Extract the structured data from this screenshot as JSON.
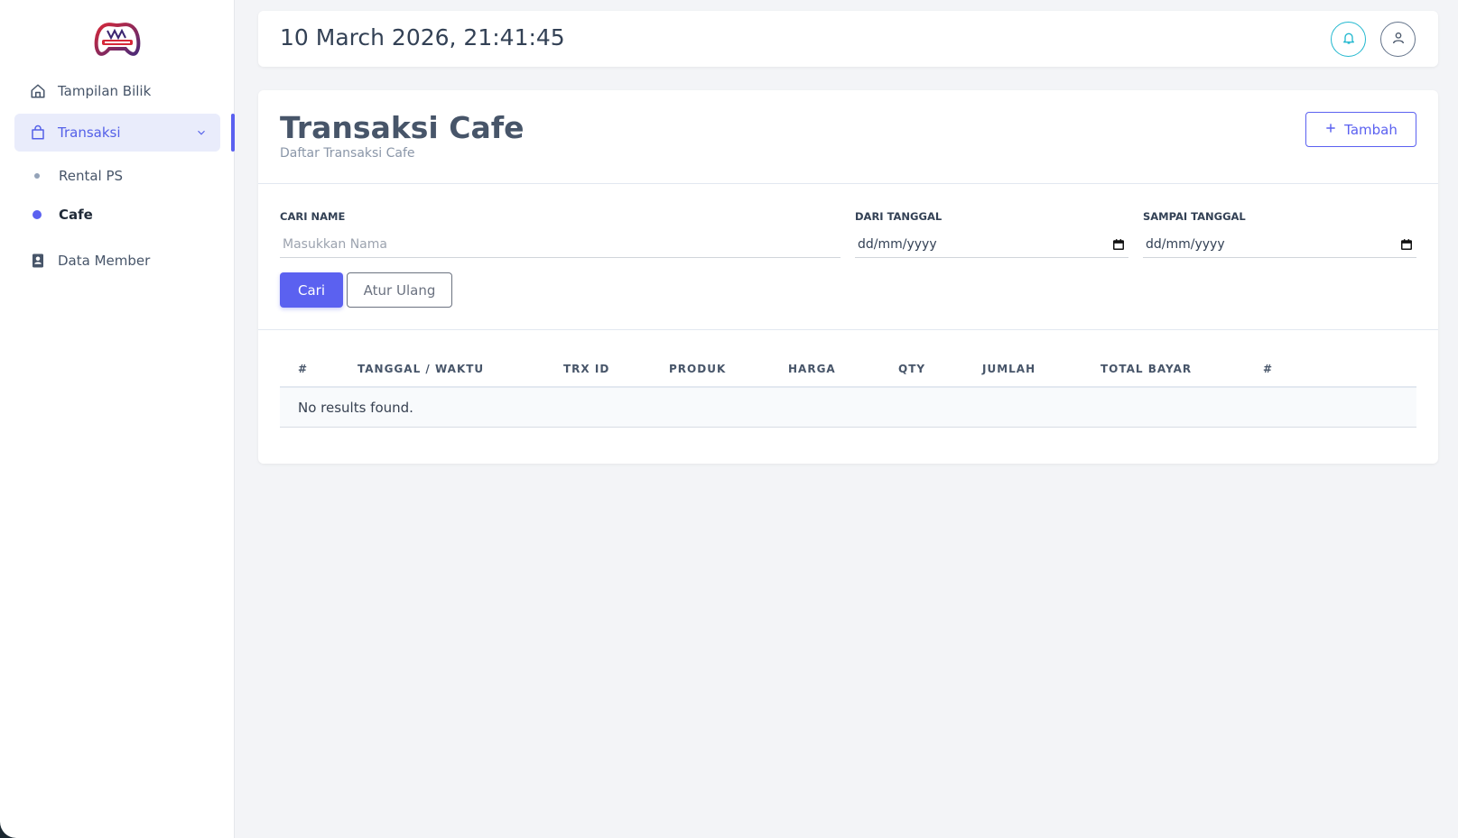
{
  "sidebar": {
    "logo_name": "game-center-logo",
    "items": [
      {
        "label": "Tampilan Bilik"
      },
      {
        "label": "Transaksi"
      },
      {
        "label": "Data Member"
      }
    ],
    "sub_items": [
      {
        "label": "Rental PS"
      },
      {
        "label": "Cafe"
      }
    ]
  },
  "header": {
    "datetime": "10 March 2026, 21:41:45"
  },
  "page": {
    "title": "Transaksi Cafe",
    "subtitle": "Daftar Transaksi Cafe",
    "add_label": "Tambah"
  },
  "filters": {
    "name_label": "CARI NAME",
    "name_placeholder": "Masukkan Nama",
    "from_label": "DARI TANGGAL",
    "from_value": "dd/mm/yyyy",
    "to_label": "SAMPAI TANGGAL",
    "to_value": "dd/mm/yyyy",
    "search_label": "Cari",
    "reset_label": "Atur Ulang"
  },
  "table": {
    "columns": [
      "#",
      "TANGGAL / WAKTU",
      "TRX ID",
      "PRODUK",
      "HARGA",
      "QTY",
      "JUMLAH",
      "TOTAL BAYAR",
      "#"
    ],
    "empty_text": "No results found."
  },
  "colors": {
    "accent": "#5b61f0",
    "bell": "#22b8cf"
  }
}
